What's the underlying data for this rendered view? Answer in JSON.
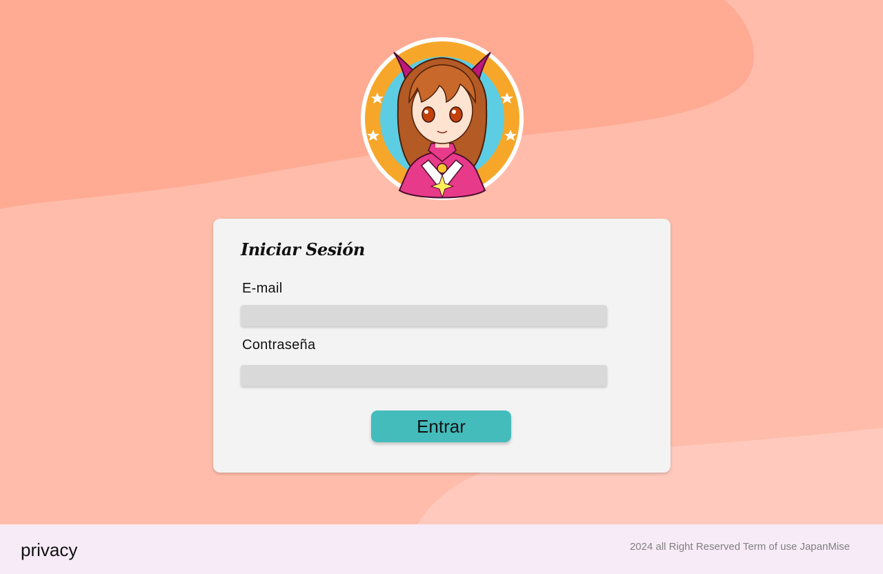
{
  "colors": {
    "background": "#ffbcaa",
    "blob_dark": "#ffab94",
    "blob_light": "#ffcabd",
    "card": "#f3f3f3",
    "input": "#d9d9d9",
    "button": "#44bcbc",
    "footer": "#f7ebf7"
  },
  "logo": {
    "icon": "anime-girl-avatar-icon"
  },
  "login": {
    "title": "Iniciar Sesión",
    "email_label": "E-mail",
    "email_value": "",
    "email_placeholder": "",
    "password_label": "Contraseña",
    "password_value": "",
    "password_placeholder": "",
    "submit_label": "Entrar"
  },
  "footer": {
    "privacy_label": "privacy",
    "copyright": "2024 all Right Reserved Term of use JapanMise"
  }
}
